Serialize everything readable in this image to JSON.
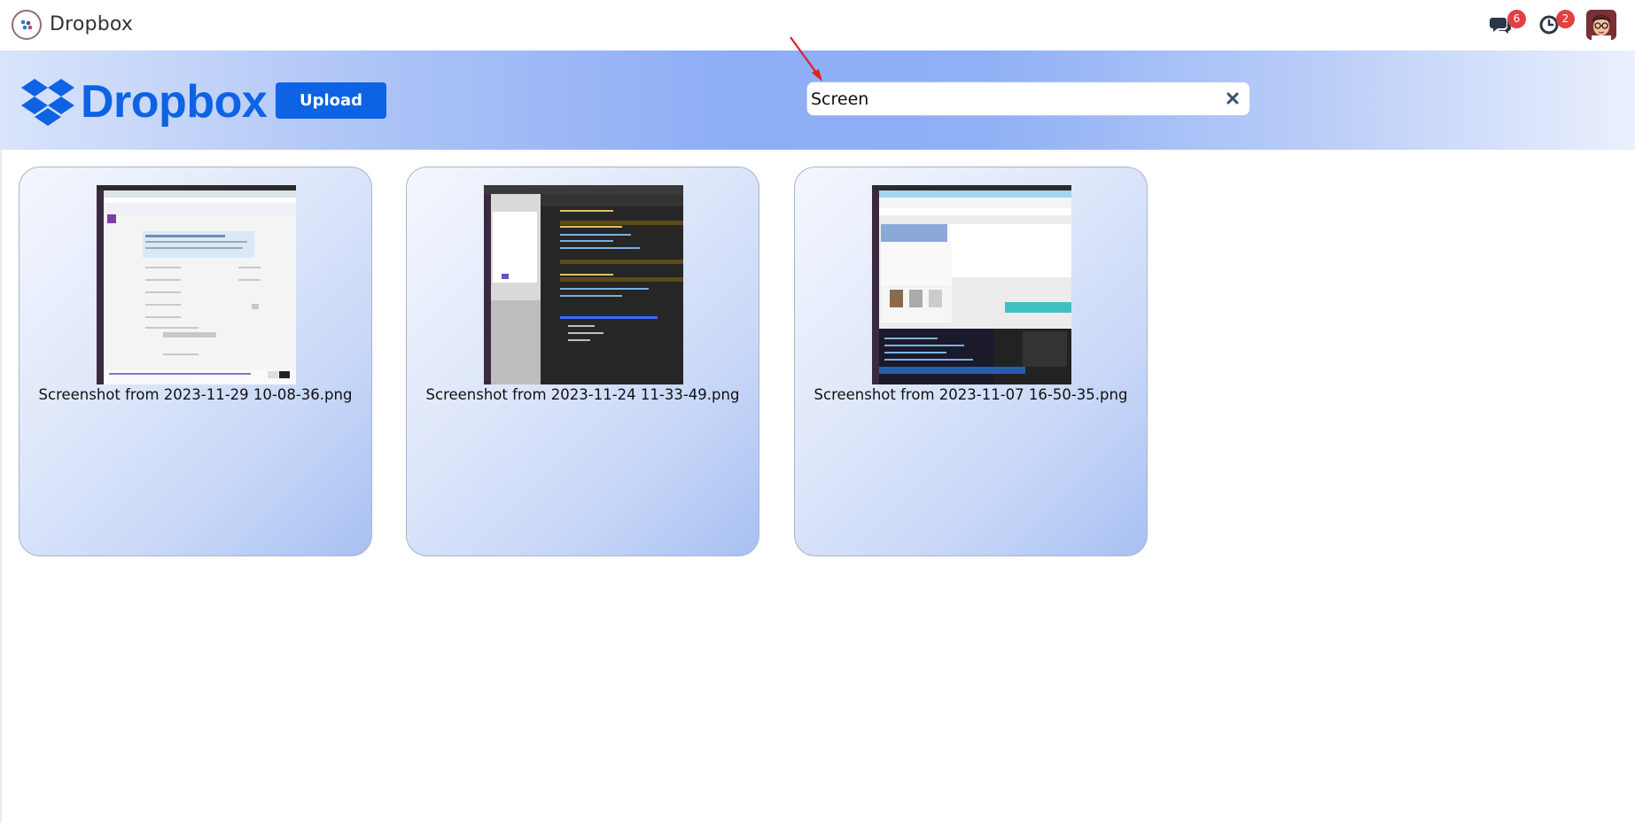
{
  "app": {
    "title": "Dropbox"
  },
  "topbar": {
    "messages_badge": "6",
    "activity_badge": "2"
  },
  "banner": {
    "brand_text": "Dropbox",
    "upload_label": "Upload",
    "search_value": "Screen",
    "colors": {
      "brand_blue": "#0d63e4",
      "badge_red": "#e04242"
    }
  },
  "files": [
    {
      "name": "Screenshot from 2023-11-29 10-08-36.png"
    },
    {
      "name": "Screenshot from 2023-11-24 11-33-49.png"
    },
    {
      "name": "Screenshot from 2023-11-07 16-50-35.png"
    }
  ],
  "icons": {
    "app_logo": "dropbox-app-icon",
    "messages": "chat-bubbles-icon",
    "activity": "clock-icon",
    "clear": "close-icon",
    "brand": "dropbox-logo-icon"
  }
}
